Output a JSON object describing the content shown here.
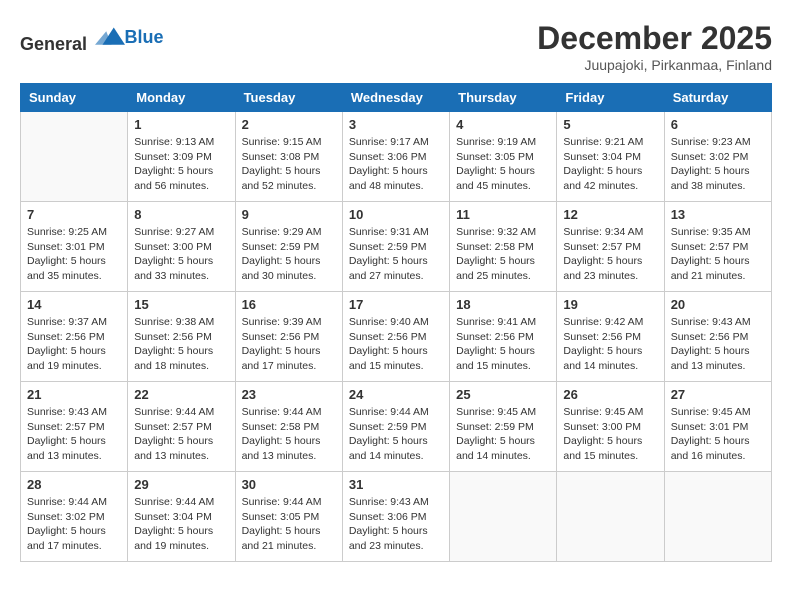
{
  "logo": {
    "text_general": "General",
    "text_blue": "Blue"
  },
  "title": "December 2025",
  "subtitle": "Juupajoki, Pirkanmaa, Finland",
  "days": [
    "Sunday",
    "Monday",
    "Tuesday",
    "Wednesday",
    "Thursday",
    "Friday",
    "Saturday"
  ],
  "weeks": [
    [
      {
        "date": "",
        "info": ""
      },
      {
        "date": "1",
        "info": "Sunrise: 9:13 AM\nSunset: 3:09 PM\nDaylight: 5 hours\nand 56 minutes."
      },
      {
        "date": "2",
        "info": "Sunrise: 9:15 AM\nSunset: 3:08 PM\nDaylight: 5 hours\nand 52 minutes."
      },
      {
        "date": "3",
        "info": "Sunrise: 9:17 AM\nSunset: 3:06 PM\nDaylight: 5 hours\nand 48 minutes."
      },
      {
        "date": "4",
        "info": "Sunrise: 9:19 AM\nSunset: 3:05 PM\nDaylight: 5 hours\nand 45 minutes."
      },
      {
        "date": "5",
        "info": "Sunrise: 9:21 AM\nSunset: 3:04 PM\nDaylight: 5 hours\nand 42 minutes."
      },
      {
        "date": "6",
        "info": "Sunrise: 9:23 AM\nSunset: 3:02 PM\nDaylight: 5 hours\nand 38 minutes."
      }
    ],
    [
      {
        "date": "7",
        "info": "Sunrise: 9:25 AM\nSunset: 3:01 PM\nDaylight: 5 hours\nand 35 minutes."
      },
      {
        "date": "8",
        "info": "Sunrise: 9:27 AM\nSunset: 3:00 PM\nDaylight: 5 hours\nand 33 minutes."
      },
      {
        "date": "9",
        "info": "Sunrise: 9:29 AM\nSunset: 2:59 PM\nDaylight: 5 hours\nand 30 minutes."
      },
      {
        "date": "10",
        "info": "Sunrise: 9:31 AM\nSunset: 2:59 PM\nDaylight: 5 hours\nand 27 minutes."
      },
      {
        "date": "11",
        "info": "Sunrise: 9:32 AM\nSunset: 2:58 PM\nDaylight: 5 hours\nand 25 minutes."
      },
      {
        "date": "12",
        "info": "Sunrise: 9:34 AM\nSunset: 2:57 PM\nDaylight: 5 hours\nand 23 minutes."
      },
      {
        "date": "13",
        "info": "Sunrise: 9:35 AM\nSunset: 2:57 PM\nDaylight: 5 hours\nand 21 minutes."
      }
    ],
    [
      {
        "date": "14",
        "info": "Sunrise: 9:37 AM\nSunset: 2:56 PM\nDaylight: 5 hours\nand 19 minutes."
      },
      {
        "date": "15",
        "info": "Sunrise: 9:38 AM\nSunset: 2:56 PM\nDaylight: 5 hours\nand 18 minutes."
      },
      {
        "date": "16",
        "info": "Sunrise: 9:39 AM\nSunset: 2:56 PM\nDaylight: 5 hours\nand 17 minutes."
      },
      {
        "date": "17",
        "info": "Sunrise: 9:40 AM\nSunset: 2:56 PM\nDaylight: 5 hours\nand 15 minutes."
      },
      {
        "date": "18",
        "info": "Sunrise: 9:41 AM\nSunset: 2:56 PM\nDaylight: 5 hours\nand 15 minutes."
      },
      {
        "date": "19",
        "info": "Sunrise: 9:42 AM\nSunset: 2:56 PM\nDaylight: 5 hours\nand 14 minutes."
      },
      {
        "date": "20",
        "info": "Sunrise: 9:43 AM\nSunset: 2:56 PM\nDaylight: 5 hours\nand 13 minutes."
      }
    ],
    [
      {
        "date": "21",
        "info": "Sunrise: 9:43 AM\nSunset: 2:57 PM\nDaylight: 5 hours\nand 13 minutes."
      },
      {
        "date": "22",
        "info": "Sunrise: 9:44 AM\nSunset: 2:57 PM\nDaylight: 5 hours\nand 13 minutes."
      },
      {
        "date": "23",
        "info": "Sunrise: 9:44 AM\nSunset: 2:58 PM\nDaylight: 5 hours\nand 13 minutes."
      },
      {
        "date": "24",
        "info": "Sunrise: 9:44 AM\nSunset: 2:59 PM\nDaylight: 5 hours\nand 14 minutes."
      },
      {
        "date": "25",
        "info": "Sunrise: 9:45 AM\nSunset: 2:59 PM\nDaylight: 5 hours\nand 14 minutes."
      },
      {
        "date": "26",
        "info": "Sunrise: 9:45 AM\nSunset: 3:00 PM\nDaylight: 5 hours\nand 15 minutes."
      },
      {
        "date": "27",
        "info": "Sunrise: 9:45 AM\nSunset: 3:01 PM\nDaylight: 5 hours\nand 16 minutes."
      }
    ],
    [
      {
        "date": "28",
        "info": "Sunrise: 9:44 AM\nSunset: 3:02 PM\nDaylight: 5 hours\nand 17 minutes."
      },
      {
        "date": "29",
        "info": "Sunrise: 9:44 AM\nSunset: 3:04 PM\nDaylight: 5 hours\nand 19 minutes."
      },
      {
        "date": "30",
        "info": "Sunrise: 9:44 AM\nSunset: 3:05 PM\nDaylight: 5 hours\nand 21 minutes."
      },
      {
        "date": "31",
        "info": "Sunrise: 9:43 AM\nSunset: 3:06 PM\nDaylight: 5 hours\nand 23 minutes."
      },
      {
        "date": "",
        "info": ""
      },
      {
        "date": "",
        "info": ""
      },
      {
        "date": "",
        "info": ""
      }
    ]
  ]
}
